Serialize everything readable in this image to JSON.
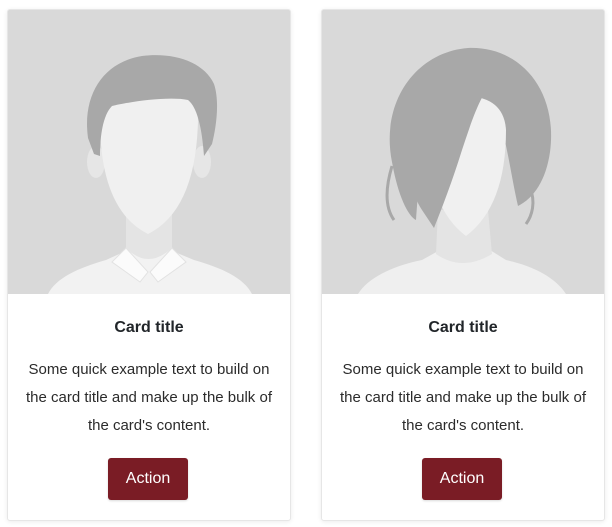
{
  "cards": [
    {
      "title": "Card title",
      "text": "Some quick example text to build on the card title and make up the bulk of the card's content.",
      "button_label": "Action",
      "avatar_icon": "male-avatar-icon"
    },
    {
      "title": "Card title",
      "text": "Some quick example text to build on the card title and make up the bulk of the card's content.",
      "button_label": "Action",
      "avatar_icon": "female-avatar-icon"
    }
  ],
  "colors": {
    "button_bg": "#7a1c25",
    "avatar_bg": "#d9d9d9",
    "silhouette_dark": "#a8a8a8",
    "silhouette_light": "#f0f0f0"
  }
}
